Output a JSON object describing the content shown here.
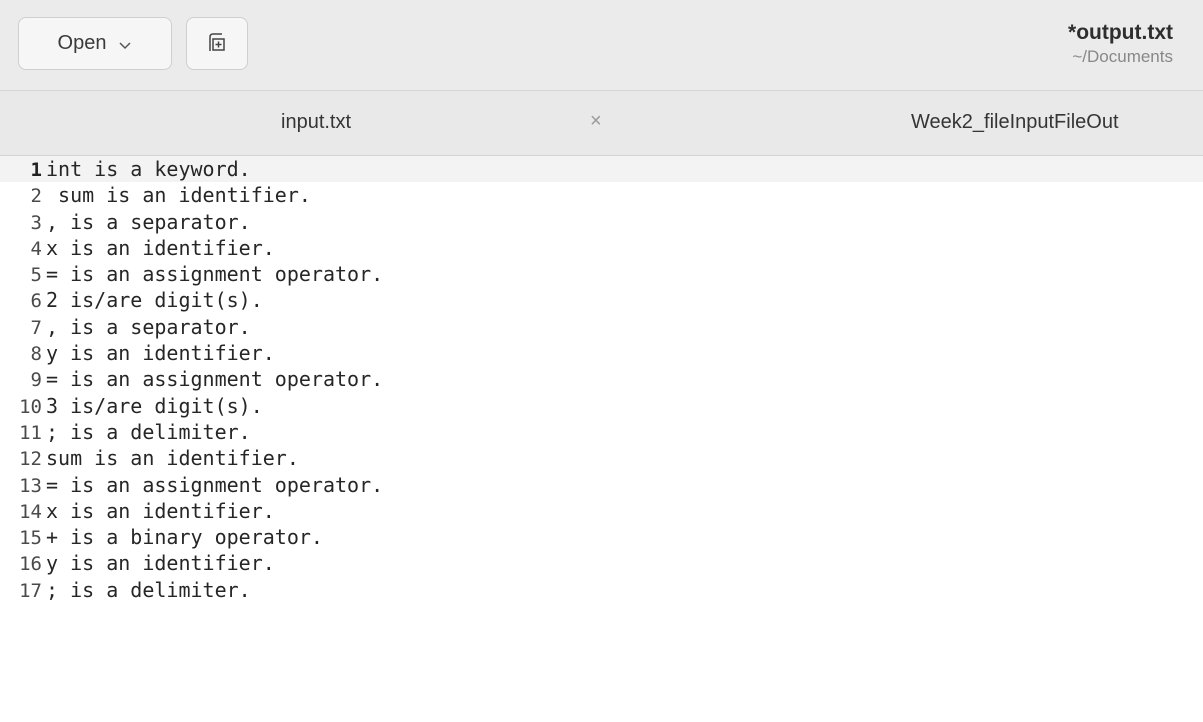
{
  "header": {
    "open_label": "Open",
    "title": "*output.txt",
    "subtitle": "~/Documents"
  },
  "tabs": [
    {
      "label": "input.txt",
      "close": "×"
    },
    {
      "label": "Week2_fileInputFileOut"
    }
  ],
  "editor": {
    "lines": [
      {
        "num": "1",
        "text": "int is a keyword."
      },
      {
        "num": "2",
        "text": " sum is an identifier."
      },
      {
        "num": "3",
        "text": ", is a separator."
      },
      {
        "num": "4",
        "text": "x is an identifier."
      },
      {
        "num": "5",
        "text": "= is an assignment operator."
      },
      {
        "num": "6",
        "text": "2 is/are digit(s)."
      },
      {
        "num": "7",
        "text": ", is a separator."
      },
      {
        "num": "8",
        "text": "y is an identifier."
      },
      {
        "num": "9",
        "text": "= is an assignment operator."
      },
      {
        "num": "10",
        "text": "3 is/are digit(s)."
      },
      {
        "num": "11",
        "text": "; is a delimiter."
      },
      {
        "num": "12",
        "text": "sum is an identifier."
      },
      {
        "num": "13",
        "text": "= is an assignment operator."
      },
      {
        "num": "14",
        "text": "x is an identifier."
      },
      {
        "num": "15",
        "text": "+ is a binary operator."
      },
      {
        "num": "16",
        "text": "y is an identifier."
      },
      {
        "num": "17",
        "text": "; is a delimiter."
      }
    ]
  },
  "icons": {
    "open_dropdown": "chevron-down-icon",
    "new_tab": "new-tab-icon"
  }
}
